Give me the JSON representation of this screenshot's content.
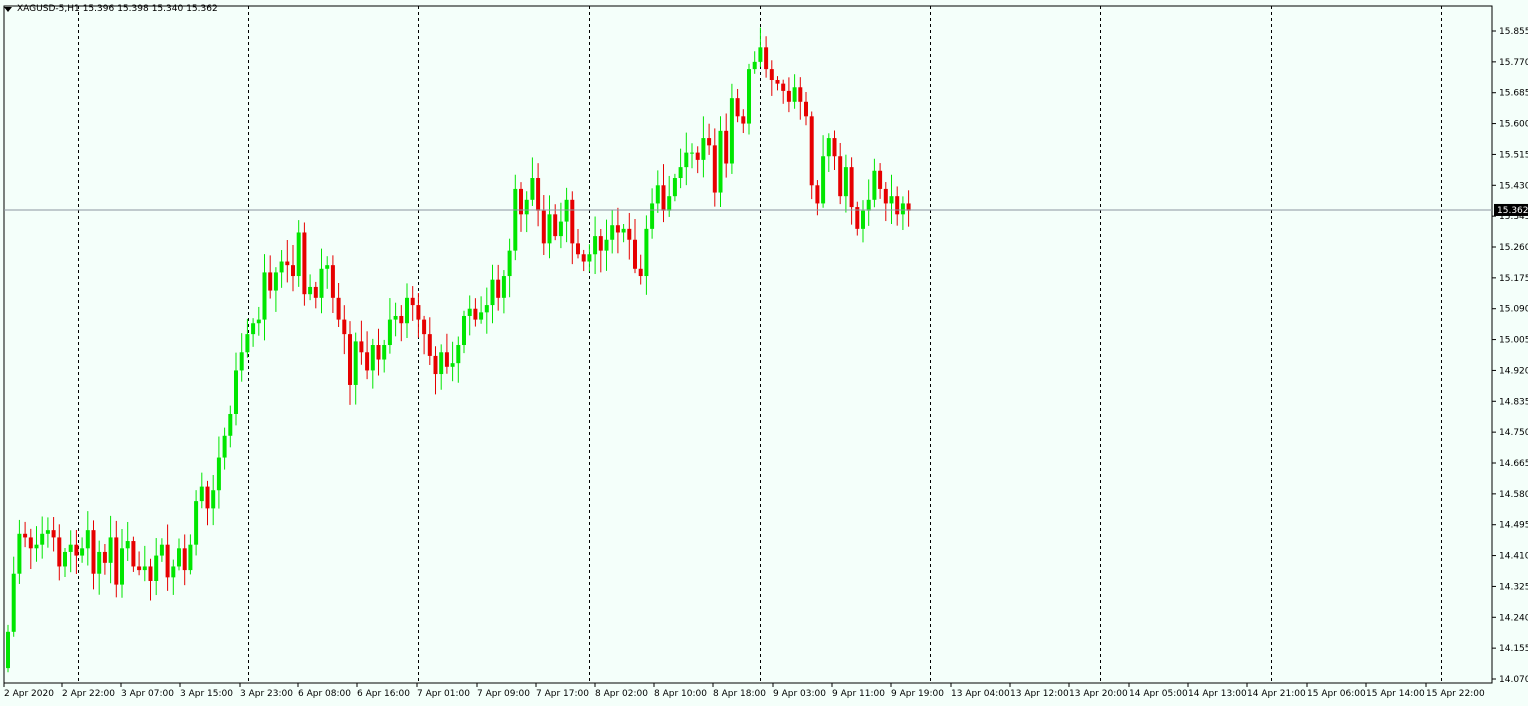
{
  "header": {
    "symbol_timeframe": "XAGUSD-5,H1",
    "open": "15.396",
    "high": "15.398",
    "low": "15.340",
    "close": "15.362"
  },
  "colors": {
    "background": "#f4fffa",
    "bull": "#00e600",
    "bear": "#e60000",
    "grid": "#000000",
    "price_line": "#8c96a0",
    "price_tag_bg": "#000000"
  },
  "chart_data": {
    "type": "candlestick",
    "timeframe": "H1",
    "ylim": [
      14.07,
      15.88
    ],
    "y_ticks": [
      "15.855",
      "15.770",
      "15.685",
      "15.600",
      "15.515",
      "15.430",
      "15.345",
      "15.260",
      "15.175",
      "15.090",
      "15.005",
      "14.920",
      "14.835",
      "14.750",
      "14.665",
      "14.580",
      "14.495",
      "14.410",
      "14.325",
      "14.240",
      "14.155",
      "14.070"
    ],
    "x_labels": [
      "2 Apr 2020",
      "2 Apr 22:00",
      "3 Apr 07:00",
      "3 Apr 15:00",
      "3 Apr 23:00",
      "6 Apr 08:00",
      "6 Apr 16:00",
      "7 Apr 01:00",
      "7 Apr 09:00",
      "7 Apr 17:00",
      "8 Apr 02:00",
      "8 Apr 10:00",
      "8 Apr 18:00",
      "9 Apr 03:00",
      "9 Apr 11:00",
      "9 Apr 19:00",
      "13 Apr 04:00",
      "13 Apr 12:00",
      "13 Apr 20:00",
      "14 Apr 05:00",
      "14 Apr 13:00",
      "14 Apr 21:00",
      "15 Apr 06:00",
      "15 Apr 14:00",
      "15 Apr 22:00"
    ],
    "current_price": 15.362,
    "current_price_label": "15.362",
    "grid": "vertical dashed day separators",
    "closes": [
      14.2,
      14.36,
      14.47,
      14.46,
      14.43,
      14.44,
      14.47,
      14.48,
      14.46,
      14.38,
      14.42,
      14.44,
      14.41,
      14.43,
      14.48,
      14.36,
      14.42,
      14.39,
      14.46,
      14.33,
      14.43,
      14.45,
      14.38,
      14.37,
      14.38,
      14.34,
      14.41,
      14.44,
      14.35,
      14.38,
      14.43,
      14.37,
      14.44,
      14.56,
      14.6,
      14.54,
      14.59,
      14.68,
      14.74,
      14.8,
      14.92,
      14.97,
      15.02,
      15.05,
      15.06,
      15.19,
      15.14,
      15.19,
      15.22,
      15.21,
      15.18,
      15.3,
      15.13,
      15.15,
      15.12,
      15.2,
      15.21,
      15.12,
      15.06,
      15.02,
      14.88,
      15.0,
      14.97,
      14.92,
      14.99,
      14.95,
      14.99,
      15.06,
      15.07,
      15.05,
      15.12,
      15.1,
      15.06,
      15.02,
      14.96,
      14.91,
      14.97,
      14.93,
      14.94,
      14.99,
      15.07,
      15.09,
      15.06,
      15.08,
      15.1,
      15.17,
      15.12,
      15.18,
      15.25,
      15.42,
      15.35,
      15.39,
      15.45,
      15.36,
      15.27,
      15.35,
      15.29,
      15.33,
      15.39,
      15.27,
      15.24,
      15.22,
      15.24,
      15.29,
      15.25,
      15.28,
      15.32,
      15.3,
      15.31,
      15.28,
      15.2,
      15.18,
      15.31,
      15.38,
      15.43,
      15.36,
      15.4,
      15.45,
      15.48,
      15.52,
      15.52,
      15.5,
      15.56,
      15.54,
      15.41,
      15.58,
      15.49,
      15.67,
      15.62,
      15.6,
      15.75,
      15.77,
      15.81,
      15.75,
      15.72,
      15.71,
      15.69,
      15.66,
      15.7,
      15.66,
      15.62,
      15.43,
      15.38,
      15.51,
      15.56,
      15.51,
      15.4,
      15.48,
      15.37,
      15.31,
      15.36,
      15.39,
      15.47,
      15.42,
      15.38,
      15.4,
      15.35,
      15.38,
      15.36
    ]
  }
}
